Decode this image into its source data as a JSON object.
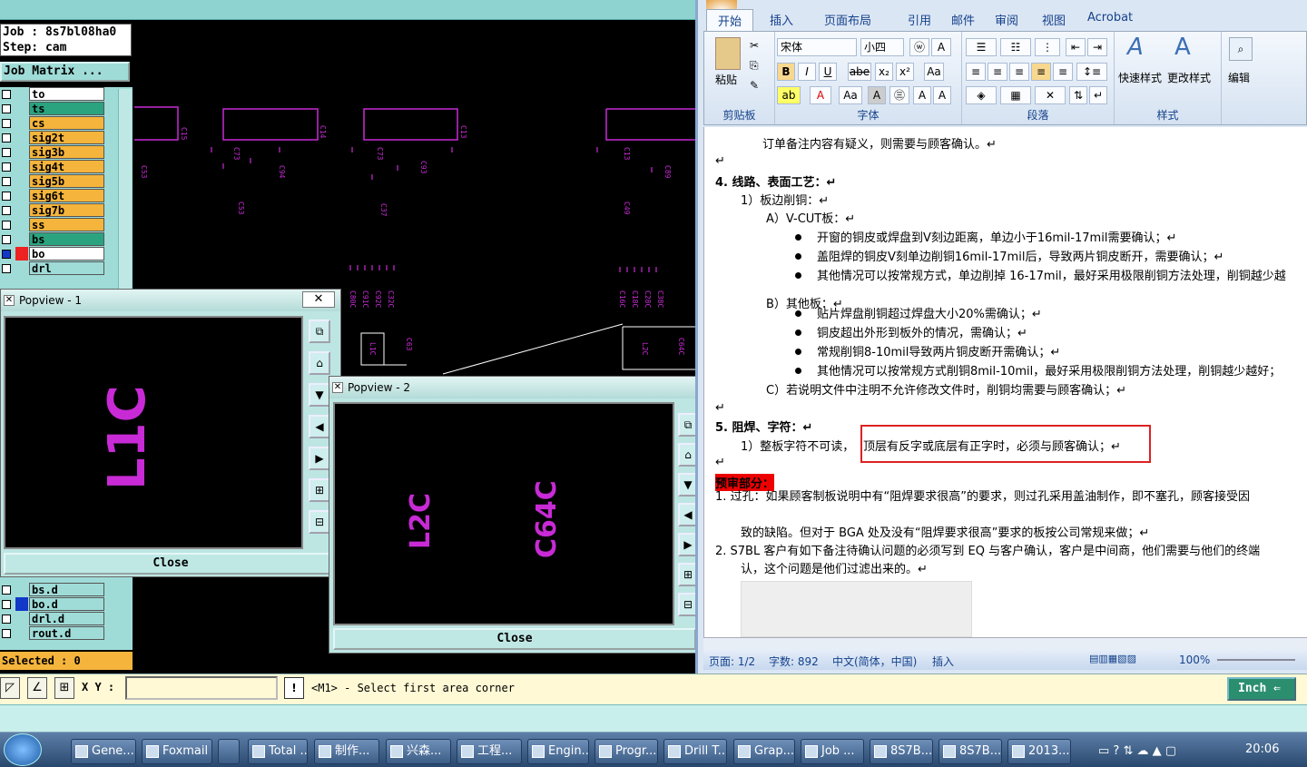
{
  "cam": {
    "job_label": "Job : 8s7bl08ha0",
    "step_label": "Step: cam",
    "job_matrix": "Job Matrix ...",
    "layers_top": [
      {
        "name": "to",
        "color": "#ffffff"
      },
      {
        "name": "ts",
        "color": "#2ba37f"
      },
      {
        "name": "cs",
        "color": "#f5b43b"
      },
      {
        "name": "sig2t",
        "color": "#f5b43b"
      },
      {
        "name": "sig3b",
        "color": "#f5b43b"
      },
      {
        "name": "sig4t",
        "color": "#f5b43b"
      },
      {
        "name": "sig5b",
        "color": "#f5b43b"
      },
      {
        "name": "sig6t",
        "color": "#f5b43b"
      },
      {
        "name": "sig7b",
        "color": "#f5b43b"
      },
      {
        "name": "ss",
        "color": "#f5b43b"
      },
      {
        "name": "bs",
        "color": "#2ba37f"
      },
      {
        "name": "bo",
        "color": "#ffffff"
      },
      {
        "name": "drl",
        "color": "#9fdcd8"
      }
    ],
    "layers_bottom": [
      {
        "name": "bs.d",
        "color": "#9fdcd8"
      },
      {
        "name": "bo.d",
        "color": "#9fdcd8"
      },
      {
        "name": "drl.d",
        "color": "#9fdcd8"
      },
      {
        "name": "rout.d",
        "color": "#9fdcd8"
      }
    ],
    "selected": "Selected : 0",
    "xy_label": "X Y :",
    "message": "<M1> - Select first area corner",
    "unit": "Inch"
  },
  "popview1": {
    "title": "Popview - 1",
    "close": "Close",
    "text": "L1C",
    "close_x": "✕"
  },
  "popview2": {
    "title": "Popview - 2",
    "close": "Close",
    "text_a": "L2C",
    "text_b": "C64C"
  },
  "word": {
    "tabs": [
      "开始",
      "插入",
      "页面布局",
      "引用",
      "邮件",
      "审阅",
      "视图",
      "Acrobat"
    ],
    "font_name": "宋体",
    "font_size": "小四",
    "groups": {
      "clipboard": "剪贴板",
      "font": "字体",
      "paragraph": "段落",
      "styles": "样式"
    },
    "paste": "粘贴",
    "quick_styles": "快速样式",
    "change_styles": "更改样式",
    "edit": "编辑",
    "doc_lines": [
      "订单备注内容有疑义，则需要与顾客确认。↵",
      "↵",
      "4.   线路、表面工艺：↵",
      "1）板边削铜：↵",
      "A）V-CUT板：↵",
      "开窗的铜皮或焊盘到V刻边距离，单边小于16mil-17mil需要确认；↵",
      "盖阻焊的铜皮V刻单边削铜16mil-17mil后，导致两片铜皮断开，需要确认；↵",
      "其他情况可以按常规方式，单边削掉 16-17mil，最好采用极限削铜方法处理，削铜越少越",
      "B）其他板：↵",
      "贴片焊盘削铜超过焊盘大小20%需确认；↵",
      "铜皮超出外形到板外的情况，需确认；↵",
      "常规削铜8-10mil导致两片铜皮断开需确认；↵",
      "其他情况可以按常规方式削铜8mil-10mil，最好采用极限削铜方法处理，削铜越少越好；",
      "C）若说明文件中注明不允许修改文件时，削铜均需要与顾客确认；↵",
      "↵",
      "5.   阻焊、字符：↵",
      "1）整板字符不可读，",
      "顶层有反字或底层有正字时，必须与顾客确认；↵",
      "↵",
      "预审部分：",
      "1.   过孔：如果顾客制板说明中有“阻焊要求很高”的要求，则过孔采用盖油制作，即不塞孔，顾客接受因",
      "致的缺陷。但对于 BGA 处及没有“阻焊要求很高”要求的板按公司常规来做；↵",
      "2.   S7BL 客户有如下备注待确认问题的必须写到 EQ 与客户确认，客户是中间商，他们需要与他们的终端",
      "认，这个问题是他们过滤出来的。↵"
    ],
    "status": {
      "page": "页面: 1/2",
      "words": "字数: 892",
      "lang": "中文(简体，中国)",
      "mode": "插入",
      "zoom": "100%"
    }
  },
  "taskbar": {
    "items": [
      "Gene...",
      "Foxmail",
      "",
      "Total ...",
      "制作...",
      "兴森...",
      "工程...",
      "Engin...",
      "Progr...",
      "Drill T...",
      "Grap...",
      "Job ...",
      "8S7B...",
      "8S7B...",
      "2013..."
    ],
    "clock": "20:06"
  }
}
